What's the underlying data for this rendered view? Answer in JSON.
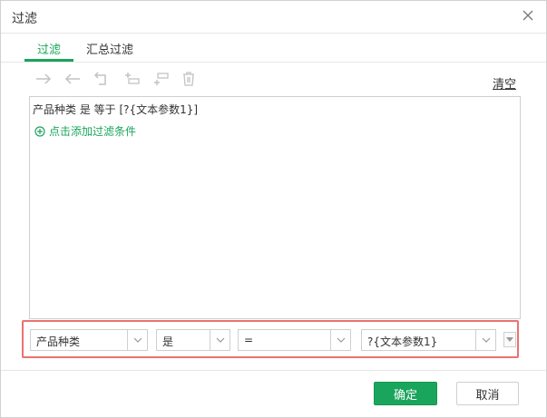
{
  "dialog": {
    "title": "过滤"
  },
  "tabs": [
    {
      "label": "过滤",
      "active": true
    },
    {
      "label": "汇总过滤",
      "active": false
    }
  ],
  "toolbar": {
    "icons": [
      "arrow-right-icon",
      "arrow-left-icon",
      "return-icon",
      "insert-above-icon",
      "insert-below-icon",
      "trash-icon"
    ],
    "clear_label": "清空"
  },
  "conditions": {
    "text": "产品种类 是 等于 [?{文本参数1}]",
    "add_label": "点击添加过滤条件"
  },
  "editor": {
    "field": "产品种类",
    "negation": "是",
    "operator": "=",
    "value": "?{文本参数1}"
  },
  "footer": {
    "ok_label": "确定",
    "cancel_label": "取消"
  },
  "colors": {
    "accent": "#1aa55c",
    "highlight_border": "#e8736f"
  }
}
